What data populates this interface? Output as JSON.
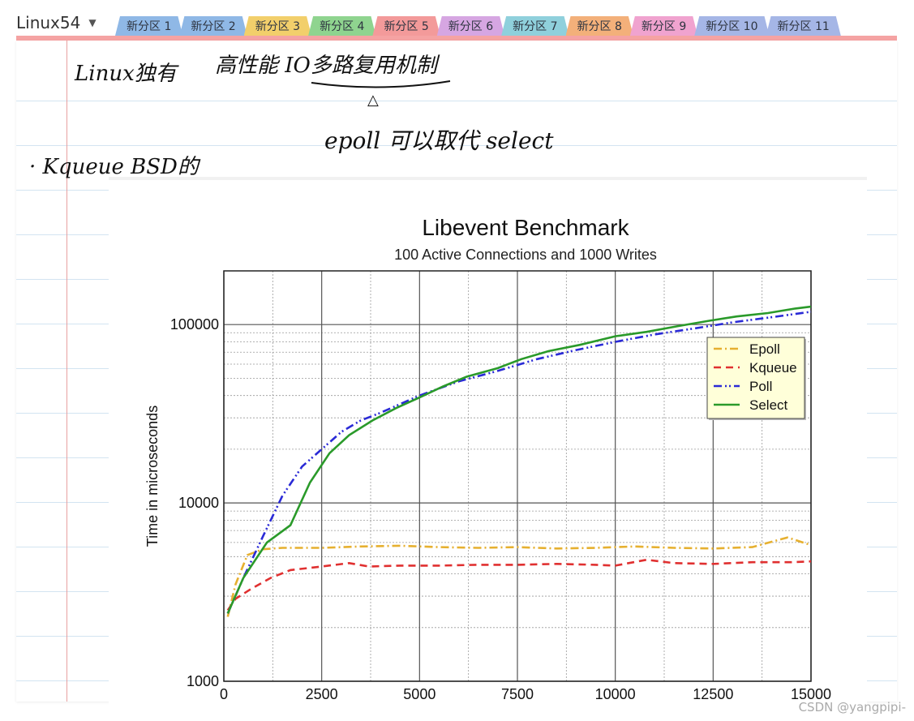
{
  "notebook": {
    "title": "Linux54"
  },
  "tabs": [
    {
      "label": "新分区 1",
      "color": "#8fb8e6"
    },
    {
      "label": "新分区 2",
      "color": "#8fb8e6"
    },
    {
      "label": "新分区 3",
      "color": "#f2cf6b"
    },
    {
      "label": "新分区 4",
      "color": "#8fd48f"
    },
    {
      "label": "新分区 5",
      "color": "#f39a9a"
    },
    {
      "label": "新分区 6",
      "color": "#d6a6e2"
    },
    {
      "label": "新分区 7",
      "color": "#8fd0dc"
    },
    {
      "label": "新分区 8",
      "color": "#f3b07a"
    },
    {
      "label": "新分区 9",
      "color": "#f0a3cf"
    },
    {
      "label": "新分区 10",
      "color": "#a5b6e6"
    },
    {
      "label": "新分区 11",
      "color": "#a5b6e6"
    }
  ],
  "notes": {
    "line1_left": "Linux独有",
    "line1_right": "高性能 IO多路复用机制",
    "arrow": "△",
    "line2": "epoll 可以取代 select",
    "line3": "· Kqueue BSD的"
  },
  "chart_data": {
    "type": "line",
    "title": "Libevent Benchmark",
    "subtitle": "100 Active Connections and 1000 Writes",
    "xlabel": "",
    "ylabel": "Time in microseconds",
    "xlim": [
      0,
      15000
    ],
    "ylim": [
      1000,
      200000
    ],
    "yscale": "log",
    "xticks": [
      0,
      2500,
      5000,
      7500,
      10000,
      12500,
      15000
    ],
    "xtick_labels": [
      "0",
      "2500",
      "5000",
      "7500",
      "10000",
      "12500",
      "15000"
    ],
    "yticks": [
      1000,
      10000,
      100000
    ],
    "ytick_labels": [
      "1000",
      "10000",
      "100000"
    ],
    "grid": true,
    "legend_position": "upper right",
    "series": [
      {
        "name": "Epoll",
        "color": "#e6b030",
        "dash": "dashdot",
        "x": [
          100,
          300,
          600,
          1000,
          1500,
          2500,
          3500,
          4500,
          5500,
          6500,
          7500,
          8500,
          9500,
          10500,
          11500,
          12500,
          13500,
          14400,
          15000
        ],
        "y": [
          2300,
          3500,
          5100,
          5500,
          5600,
          5600,
          5700,
          5750,
          5650,
          5600,
          5650,
          5550,
          5600,
          5700,
          5600,
          5550,
          5650,
          6400,
          5800
        ]
      },
      {
        "name": "Kqueue",
        "color": "#e03030",
        "dash": "dashed",
        "x": [
          100,
          300,
          700,
          1200,
          1700,
          2500,
          3200,
          3700,
          4500,
          5500,
          6500,
          7500,
          8500,
          9500,
          10000,
          10800,
          11500,
          12500,
          13500,
          14500,
          15000
        ],
        "y": [
          2500,
          2900,
          3300,
          3800,
          4200,
          4400,
          4600,
          4400,
          4450,
          4450,
          4500,
          4500,
          4550,
          4500,
          4450,
          4800,
          4600,
          4550,
          4650,
          4650,
          4700
        ]
      },
      {
        "name": "Poll",
        "color": "#2a2ad6",
        "dash": "dashdotdot",
        "x": [
          100,
          500,
          1000,
          1500,
          2000,
          2500,
          3000,
          3500,
          4000,
          5000,
          6000,
          7000,
          8000,
          9000,
          10000,
          11000,
          12000,
          13000,
          14000,
          15000
        ],
        "y": [
          2400,
          3800,
          6500,
          11000,
          16000,
          20000,
          25000,
          29000,
          32000,
          40000,
          48000,
          55000,
          64000,
          72000,
          80000,
          88000,
          95000,
          103000,
          110000,
          118000
        ]
      },
      {
        "name": "Select",
        "color": "#2a9a2a",
        "dash": "solid",
        "x": [
          100,
          500,
          1100,
          1700,
          2200,
          2700,
          3200,
          3800,
          4400,
          5000,
          5600,
          6200,
          7000,
          7600,
          8300,
          9100,
          10000,
          10800,
          11600,
          12400,
          13100,
          13900,
          14600,
          15000
        ],
        "y": [
          2400,
          3800,
          6000,
          7500,
          13000,
          19000,
          24000,
          29000,
          34000,
          39000,
          45000,
          51000,
          57000,
          64000,
          71000,
          77000,
          86000,
          91000,
          98000,
          105000,
          111000,
          116000,
          123000,
          126000
        ]
      }
    ]
  },
  "watermark": "CSDN @yangpipi-"
}
